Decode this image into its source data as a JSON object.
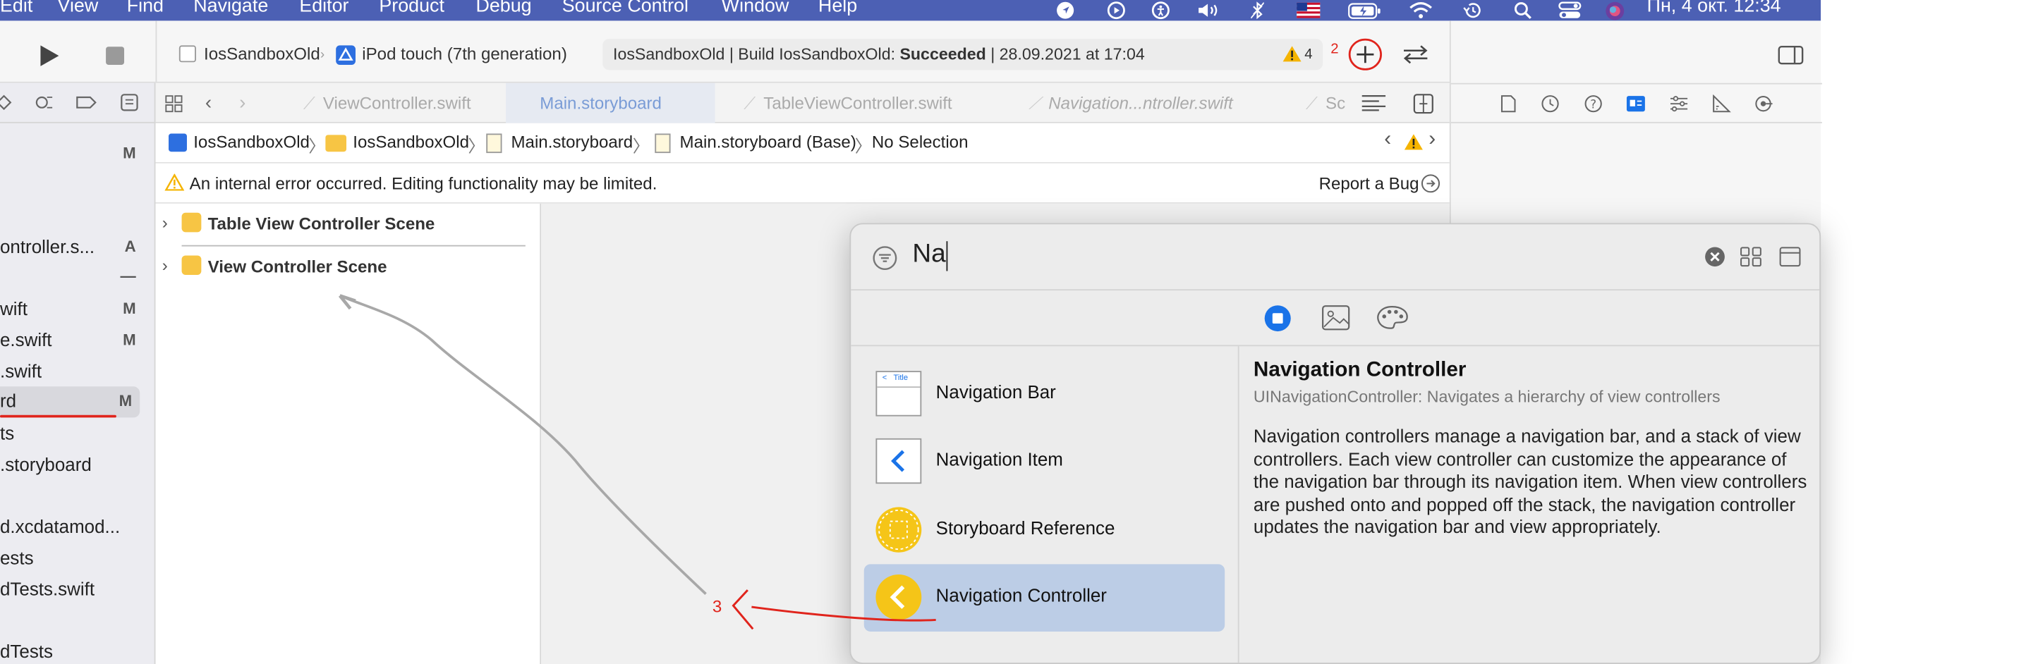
{
  "menubar": {
    "items": [
      "Edit",
      "View",
      "Find",
      "Navigate",
      "Editor",
      "Product",
      "Debug",
      "Source Control",
      "Window",
      "Help"
    ],
    "status_icons": [
      "location-icon",
      "play-circle-icon",
      "accessibility-icon",
      "volume-icon",
      "bluetooth-icon",
      "us-flag-icon",
      "battery-icon",
      "wifi-icon",
      "time-machine-icon",
      "search-icon",
      "control-center-icon",
      "siri-icon"
    ],
    "datetime": "Пн, 4 окт.  12:34",
    "bg_color": "#4c60b4"
  },
  "toolbar": {
    "scheme": "IosSandboxOld",
    "device": "iPod touch (7th generation)",
    "status_prefix": "IosSandboxOld | Build IosSandboxOld: ",
    "status_result": "Succeeded",
    "status_suffix": " | 28.09.2021 at 17:04",
    "warning_count": "4",
    "annotation_2": "2"
  },
  "navigator": {
    "rows": [
      {
        "label": "",
        "status": "M"
      },
      {
        "label": "ontroller.s...",
        "status": "A"
      },
      {
        "label": "",
        "status": "—"
      },
      {
        "label": "wift",
        "status": "M"
      },
      {
        "label": "e.swift",
        "status": "M"
      },
      {
        "label": ".swift",
        "status": ""
      },
      {
        "label": "rd",
        "status": "M"
      },
      {
        "label": "ts",
        "status": ""
      },
      {
        "label": ".storyboard",
        "status": ""
      },
      {
        "label": "",
        "status": ""
      },
      {
        "label": "d.xcdatamod...",
        "status": ""
      },
      {
        "label": "ests",
        "status": ""
      },
      {
        "label": "dTests.swift",
        "status": ""
      },
      {
        "label": "",
        "status": ""
      },
      {
        "label": "dTests",
        "status": ""
      }
    ]
  },
  "editor_tabs": [
    {
      "label": "ViewController.swift",
      "active": false,
      "italic": false
    },
    {
      "label": "Main.storyboard",
      "active": true,
      "italic": false
    },
    {
      "label": "TableViewController.swift",
      "active": false,
      "italic": false
    },
    {
      "label": "Navigation...ntroller.swift",
      "active": false,
      "italic": true
    },
    {
      "label": "Sc",
      "active": false,
      "italic": false
    }
  ],
  "breadcrumb": [
    "IosSandboxOld",
    "IosSandboxOld",
    "Main.storyboard",
    "Main.storyboard (Base)",
    "No Selection"
  ],
  "warning_banner": {
    "message": "An internal error occurred. Editing functionality may be limited.",
    "report_label": "Report a Bug"
  },
  "outline": {
    "scenes": [
      "Table View Controller Scene",
      "View Controller Scene"
    ]
  },
  "library": {
    "search_value": "Na",
    "items": [
      {
        "label": "Navigation Bar",
        "icon": "navigation-bar-icon",
        "icon_text": "Title",
        "selected": false
      },
      {
        "label": "Navigation Item",
        "icon": "navigation-item-icon",
        "selected": false
      },
      {
        "label": "Storyboard Reference",
        "icon": "storyboard-reference-icon",
        "selected": false
      },
      {
        "label": "Navigation Controller",
        "icon": "navigation-controller-icon",
        "selected": true
      }
    ],
    "detail": {
      "title": "Navigation Controller",
      "subtitle": "UINavigationController: Navigates a hierarchy of view controllers",
      "body": "Navigation controllers manage a navigation bar, and a stack of view controllers. Each view controller can customize the appearance of the navigation bar through its navigation item. When view controllers are pushed onto and popped off the stack, the navigation controller updates the navigation bar and view appropriately."
    }
  },
  "annotations": {
    "step_3": "3"
  },
  "colors": {
    "accent": "#1a73e8",
    "annotation_red": "#e0241c",
    "selected_row": "#bccde6",
    "warning": "#f5b400"
  }
}
